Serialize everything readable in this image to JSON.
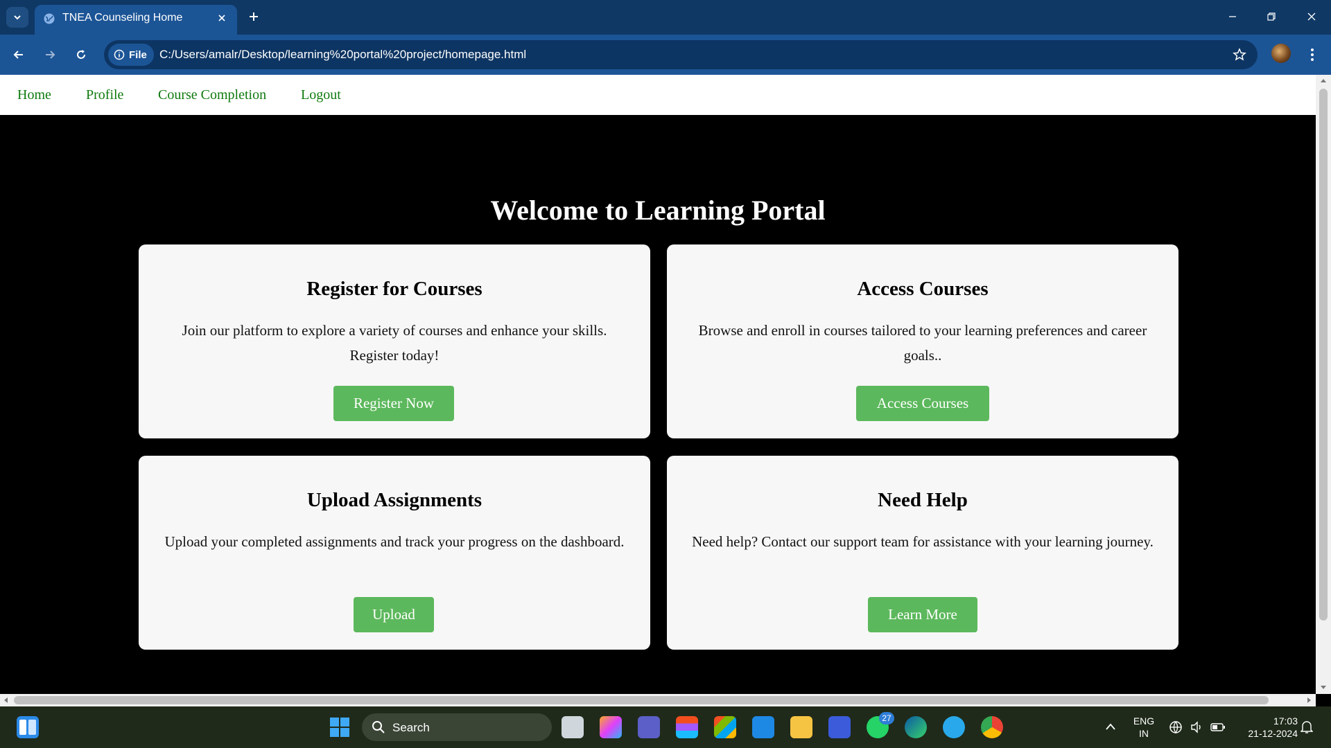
{
  "browser": {
    "tab_title": "TNEA Counseling Home",
    "chip_label": "File",
    "url": "C:/Users/amalr/Desktop/learning%20portal%20project/homepage.html"
  },
  "nav": {
    "items": [
      {
        "label": "Home"
      },
      {
        "label": "Profile"
      },
      {
        "label": "Course Completion"
      },
      {
        "label": "Logout"
      }
    ]
  },
  "hero": {
    "title": "Welcome to Learning Portal"
  },
  "cards": [
    {
      "title": "Register for Courses",
      "text": "Join our platform to explore a variety of courses and enhance your skills. Register today!",
      "button": "Register Now"
    },
    {
      "title": "Access Courses",
      "text": "Browse and enroll in courses tailored to your learning preferences and career goals..",
      "button": "Access Courses"
    },
    {
      "title": "Upload Assignments",
      "text": "Upload your completed assignments and track your progress on the dashboard.",
      "button": "Upload"
    },
    {
      "title": "Need Help",
      "text": "Need help? Contact our support team for assistance with your learning journey.",
      "button": "Learn More"
    }
  ],
  "taskbar": {
    "search_label": "Search",
    "whatsapp_badge": "27",
    "language": "ENG",
    "region": "IN",
    "time": "17:03",
    "date": "21-12-2024"
  },
  "colors": {
    "accent_green": "#5cb85c",
    "nav_link": "#0e7a0e",
    "chrome_blue": "#1c5596"
  }
}
